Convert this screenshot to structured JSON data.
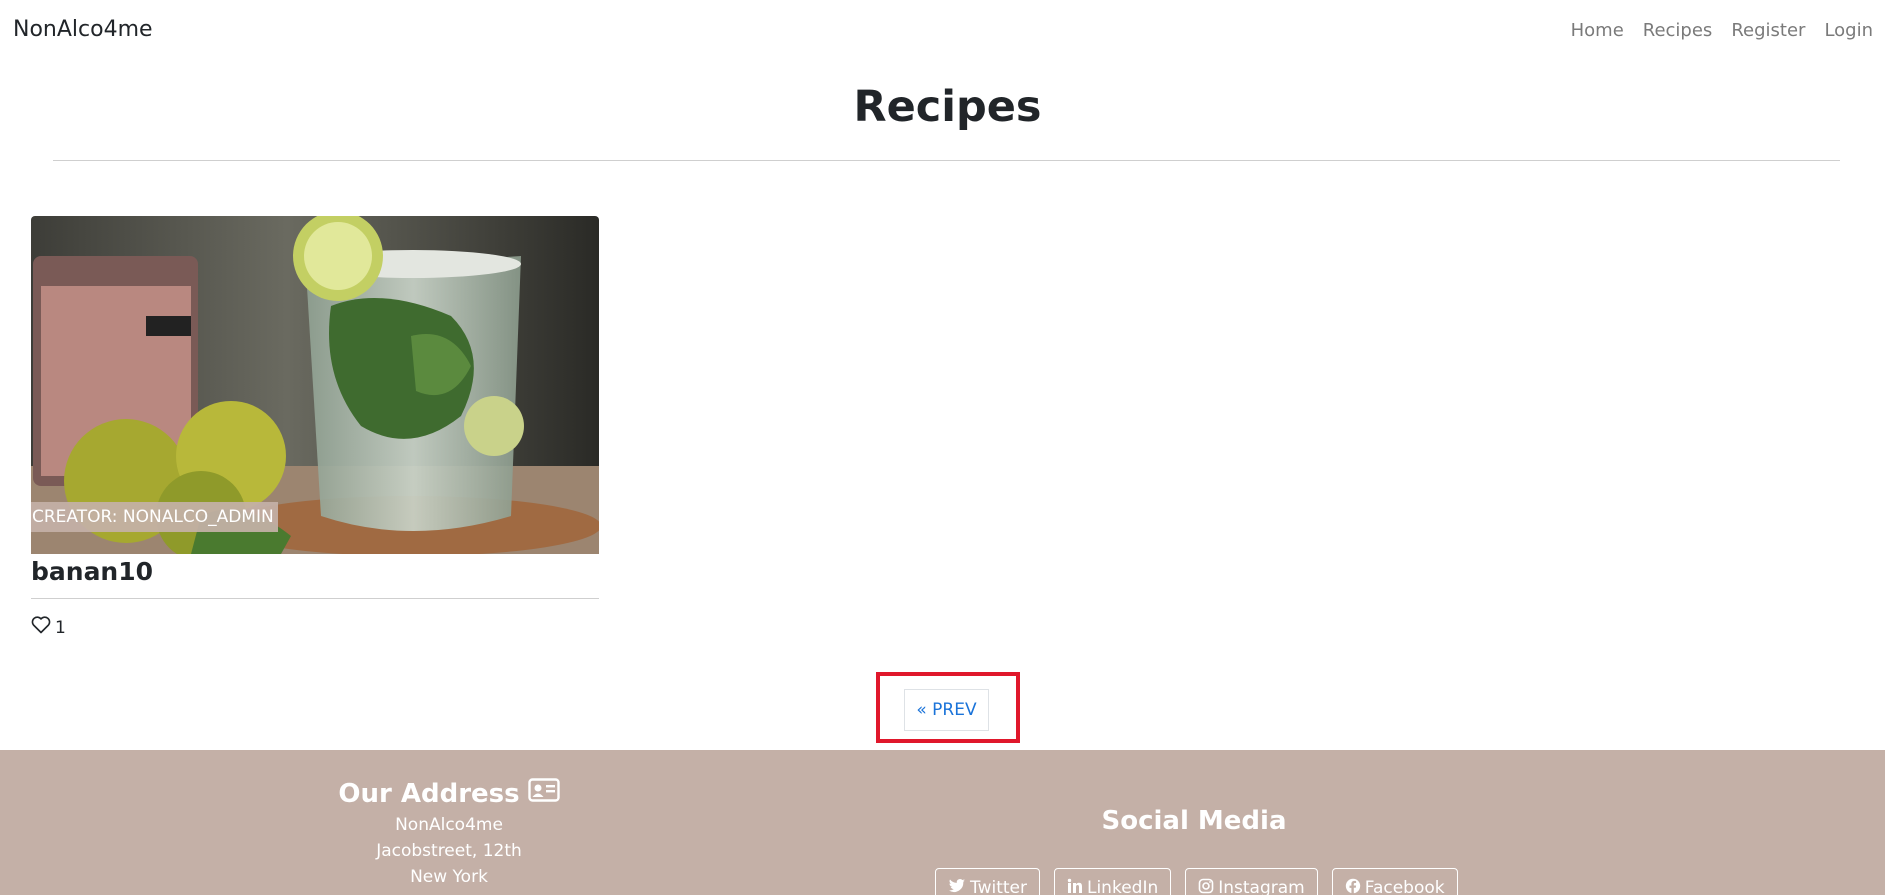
{
  "nav": {
    "brand": "NonAlco4me",
    "links": [
      "Home",
      "Recipes",
      "Register",
      "Login"
    ]
  },
  "page": {
    "title": "Recipes"
  },
  "recipes": [
    {
      "creator": "CREATOR: NONALCO_ADMIN",
      "title": "banan10",
      "likes": "1"
    }
  ],
  "pagination": {
    "prev_label": "« PREV"
  },
  "footer": {
    "address_heading": "Our Address",
    "address_lines": [
      "NonAlco4me",
      "Jacobstreet, 12th",
      "New York"
    ],
    "social_heading": "Social Media",
    "social_links": [
      "Twitter",
      "LinkedIn",
      "Instagram",
      "Facebook"
    ]
  },
  "colors": {
    "footer_bg": "#c4b0a7",
    "link_blue": "#1a73d9",
    "highlight_red": "#e0172b"
  }
}
